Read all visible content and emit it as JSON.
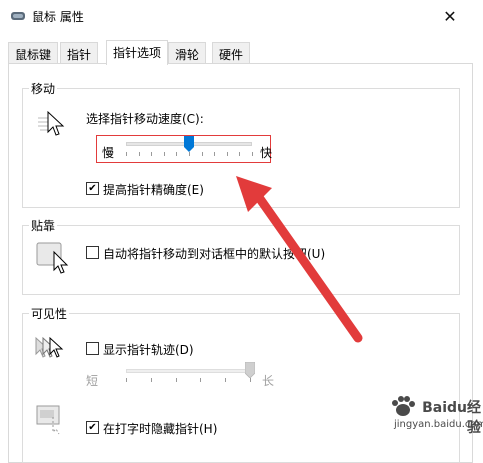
{
  "window": {
    "title": "鼠标 属性",
    "close_glyph": "✕"
  },
  "tabs": [
    {
      "label": "鼠标键",
      "active": false
    },
    {
      "label": "指针",
      "active": false
    },
    {
      "label": "指针选项",
      "active": true
    },
    {
      "label": "滑轮",
      "active": false
    },
    {
      "label": "硬件",
      "active": false
    }
  ],
  "motion": {
    "group_label": "移动",
    "speed_label": "选择指针移动速度(C):",
    "slow": "慢",
    "fast": "快",
    "speed_value": 0.5,
    "precision_label": "提高指针精确度(E)",
    "precision_checked": true
  },
  "snap": {
    "group_label": "贴靠",
    "snap_label": "自动将指针移动到对话框中的默认按钮(U)",
    "snap_checked": false
  },
  "visibility": {
    "group_label": "可见性",
    "trails_label": "显示指针轨迹(D)",
    "trails_checked": false,
    "short": "短",
    "long": "长",
    "trails_value": 1.0,
    "hide_label": "在打字时隐藏指针(H)",
    "hide_checked": true
  },
  "annotation": {
    "highlight_color": "#e23b3b"
  },
  "watermark": {
    "line1": "Baidu经验",
    "line2": "jingyan.baidu.com"
  }
}
